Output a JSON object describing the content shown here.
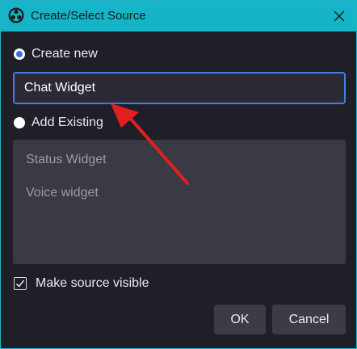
{
  "window": {
    "title": "Create/Select Source",
    "accent_color": "#15b4c8"
  },
  "options": {
    "create_new_label": "Create new",
    "create_new_selected": true,
    "add_existing_label": "Add Existing",
    "add_existing_selected": false
  },
  "name_field": {
    "value": "Chat Widget"
  },
  "existing_sources": [
    "Status Widget",
    "Voice widget"
  ],
  "visibility": {
    "label": "Make source visible",
    "checked": true
  },
  "buttons": {
    "ok_label": "OK",
    "cancel_label": "Cancel"
  },
  "icons": {
    "app": "obs-logo-icon",
    "close": "close-icon",
    "annotation": "red-arrow-icon"
  }
}
